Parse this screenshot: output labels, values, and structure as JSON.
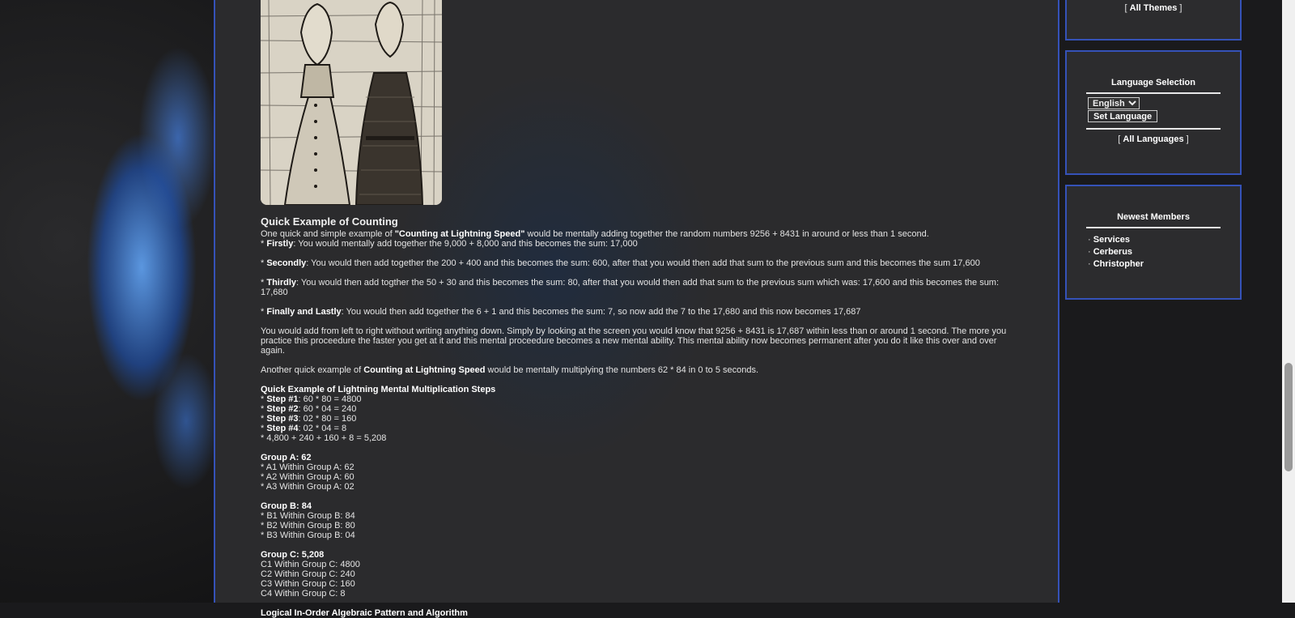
{
  "sidebar": {
    "themes": {
      "link": "All Themes",
      "open": "[",
      "close": "]"
    },
    "language": {
      "title": "Language Selection",
      "selected": "English",
      "options": [
        "English"
      ],
      "button": "Set Language",
      "all_link": "All Languages",
      "open": "[",
      "close": "]"
    },
    "members": {
      "title": "Newest Members",
      "bullet": "·",
      "items": [
        "Services",
        "Cerberus",
        "Christopher"
      ]
    }
  },
  "article": {
    "heading": "Quick Example of Counting",
    "intro": {
      "a": "One quick and simple example of ",
      "b": "\"Counting at Lightning Speed\"",
      "c": " would be mentally adding together the random numbers 9256 + 8431 in around or less than 1 second."
    },
    "firstly": {
      "pre": "* ",
      "b": "Firstly",
      "c": ": You would mentally add together the 9,000 + 8,000 and this becomes the sum: 17,000"
    },
    "secondly": {
      "pre": "* ",
      "b": "Secondly",
      "c": ": You would then add together the 200 + 400 and this becomes the sum: 600, after that you would then add that sum to the previous sum and this becomes the sum 17,600"
    },
    "thirdly": {
      "pre": "* ",
      "b": "Thirdly",
      "c": ": You would then add togther the 50 + 30 and this becomes the sum: 80, after that you would then add that sum to the previous sum which was: 17,600 and this becomes the sum: 17,680"
    },
    "lastly": {
      "pre": "* ",
      "b": "Finally and Lastly",
      "c": ": You would then add together the 6 + 1 and this becomes the sum: 7, so now add the 7 to the 17,680 and this now becomes 17,687"
    },
    "explain": "You would add from left to right without writing anything down. Simply by looking at the screen you would know that 9256 + 8431 is 17,687 within less than or around 1 second. The more you practice this proceedure the faster you get at it and this mental proceedure becomes a new mental ability. This mental ability now becomes permanent after you do it like this over and over again.",
    "another": {
      "a": "Another quick example of ",
      "b": "Counting at Lightning Speed",
      "c": " would be mentally multiplying the numbers 62 * 84 in 0 to 5 seconds."
    },
    "mult_heading": "Quick Example of Lightning Mental Multiplication Steps",
    "steps": [
      {
        "pre": "* ",
        "b": "Step #1",
        "c": ": 60 * 80 = 4800"
      },
      {
        "pre": "* ",
        "b": "Step #2",
        "c": ": 60 * 04 = 240"
      },
      {
        "pre": "* ",
        "b": "Step #3",
        "c": ": 02 * 80 = 160"
      },
      {
        "pre": "* ",
        "b": "Step #4",
        "c": ": 02 * 04 = 8"
      }
    ],
    "total": "* 4,800 + 240 + 160 + 8 = 5,208",
    "groupA": {
      "title": "Group A: 62",
      "items": [
        "* A1 Within Group A: 62",
        "* A2 Within Group A: 60",
        "* A3 Within Group A: 02"
      ]
    },
    "groupB": {
      "title": "Group B: 84",
      "items": [
        "* B1 Within Group B: 84",
        "* B2 Within Group B: 80",
        "* B3 Within Group B: 04"
      ]
    },
    "groupC": {
      "title": "Group C: 5,208",
      "items": [
        "C1 Within Group C: 4800",
        "C2 Within Group C: 240",
        "C3 Within Group C: 160",
        "C4 Within Group C: 8"
      ]
    },
    "next_heading": "Logical In-Order Algebraic Pattern and Algorithm"
  },
  "colors": {
    "accent": "#3552b8",
    "background": "#2b2b2d"
  }
}
